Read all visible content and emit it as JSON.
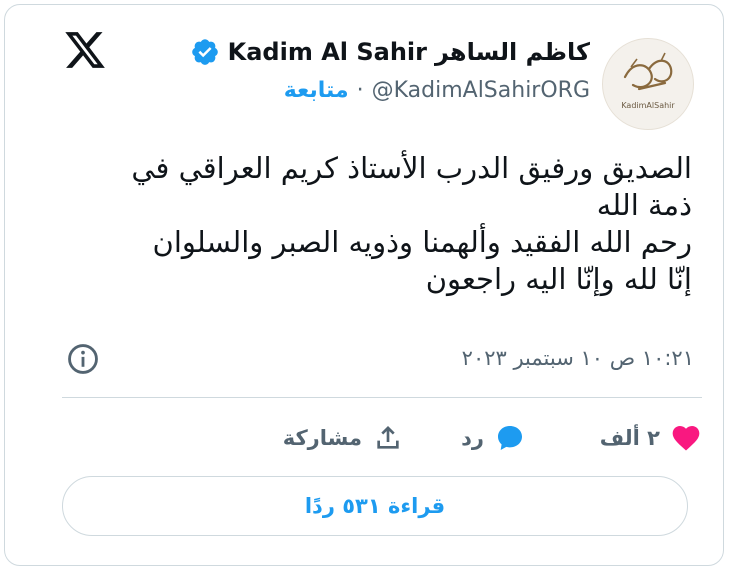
{
  "author": {
    "name_ar": "كاظم الساهر",
    "name_en": "Kadim Al Sahir",
    "handle": "@KadimAlSahirORG",
    "follow_label": "متابعة",
    "separator": "·",
    "avatar_caption": "KadimAlSahir"
  },
  "tweet": {
    "lines": [
      "الصديق ورفيق الدرب الأستاذ كريم العراقي في",
      "ذمة الله",
      "رحم الله الفقيد وألهمنا وذويه الصبر والسلوان",
      "إنّا لله وإنّا اليه راجعون"
    ],
    "timestamp": "١٠:٢١ ص ١٠ سبتمبر ٢٠٢٣"
  },
  "actions": {
    "like_count": "٢ ألف",
    "reply_label": "رد",
    "share_label": "مشاركة"
  },
  "read_replies": "قراءة ٥٣١ ردًا",
  "icons": {
    "logo": "x-logo-icon",
    "verified": "verified-badge-icon",
    "info": "info-icon",
    "like": "heart-icon",
    "reply": "comment-bubble-icon",
    "share": "share-upload-icon"
  },
  "colors": {
    "accent": "#1d9bf0",
    "like": "#f91880",
    "text": "#0f1419",
    "muted": "#536471",
    "border": "#cfd9de"
  }
}
